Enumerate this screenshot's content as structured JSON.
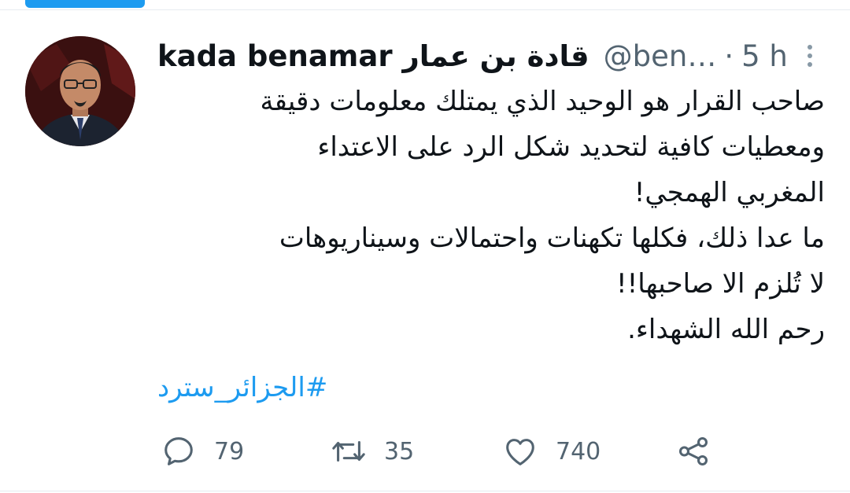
{
  "tweet": {
    "author_name": "kada benamar قادة بن عمار",
    "handle": "@ben…",
    "separator": "·",
    "time": "5 h",
    "text_lines": [
      "صاحب القرار هو الوحيد الذي يمتلك معلومات دقيقة",
      "ومعطيات كافية لتحديد شكل الرد على الاعتداء",
      "المغربي الهمجي!",
      "ما عدا ذلك، فكلها تكهنات واحتمالات وسيناريوهات",
      "لا تُلزم الا صاحبها!!",
      "رحم الله الشهداء."
    ],
    "hashtag": "#الجزائر_سترد"
  },
  "actions": {
    "reply_count": "79",
    "retweet_count": "35",
    "like_count": "740"
  },
  "colors": {
    "accent": "#1d9bf0",
    "secondary_text": "#536471",
    "primary_text": "#0f1419"
  },
  "icons": {
    "reply": "reply-icon",
    "retweet": "retweet-icon",
    "like": "heart-icon",
    "share": "share-icon",
    "more": "more-options-icon"
  }
}
